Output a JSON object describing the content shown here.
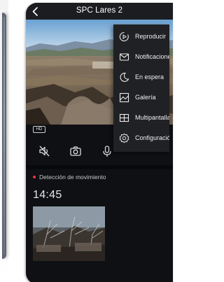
{
  "header": {
    "title": "SPC Lares 2"
  },
  "video": {
    "quality_badge": "HD"
  },
  "controls": [
    {
      "icon": "speaker-muted-icon"
    },
    {
      "icon": "camera-icon"
    },
    {
      "icon": "microphone-icon"
    }
  ],
  "menu": {
    "items": [
      {
        "label": "Reproducir",
        "icon": "playback-icon"
      },
      {
        "label": "Notificaciones",
        "icon": "envelope-icon"
      },
      {
        "label": "En espera",
        "icon": "moon-icon"
      },
      {
        "label": "Galería",
        "icon": "gallery-icon"
      },
      {
        "label": "Multipantalla",
        "icon": "multiscreen-icon"
      },
      {
        "label": "Configuración",
        "icon": "gear-icon"
      }
    ]
  },
  "events": {
    "type_label": "Detección de movimiento",
    "time": "14:45"
  },
  "colors": {
    "background": "#0f1013",
    "topbar": "#1c1d21",
    "menu": "#202124",
    "event_dot": "#e5393f"
  }
}
